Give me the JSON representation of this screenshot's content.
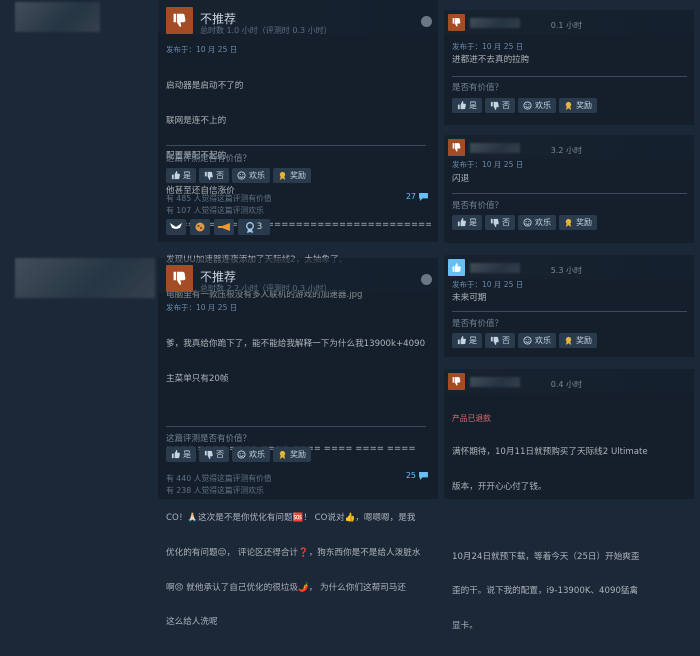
{
  "review1": {
    "verdict": "不推荐",
    "hours": "总时数 1.0 小时（评测时 0.3 小时）",
    "posted": "发布于：10 月 25 日",
    "lines": [
      "启动器是启动不了的",
      "联网是连不上的",
      "配置是配不起的",
      "他甚至还自信涨价",
      "=============================================",
      "发现UU加速器连夜添加了天际线2，太抽象了。",
      "电脑里有一款压根没有多人联机的游戏的加速器.jpg"
    ],
    "helpful_q": "这篇评测是否有价值？",
    "buttons": {
      "yes": "是",
      "no": "否",
      "funny": "欢乐",
      "award": "奖励"
    },
    "stat1": "有 485 人觉得这篇评测有价值",
    "stat2": "有 107 人觉得这篇评测欢乐",
    "comments": "27",
    "award_count": "3"
  },
  "review2": {
    "verdict": "不推荐",
    "hours": "总时数 2.2 小时（评测时 0.3 小时）",
    "posted": "发布于：10 月 25 日",
    "lines": [
      "爹，我真给你跪下了，能不能给我解释一下为什么我13900k+4090",
      "主菜单只有20帧",
      "",
      "==== ==== ==== ==== ==== ==== ==== ====",
      "",
      "CO！🙏🏻这次是不是你优化有问题🆘！ CO说对👍，嗯嗯嗯，是我",
      "优化的有问题😔， 评论区还得合计❓，狗东西你是不是给人泼脏水",
      "啊😠 就他承认了自己优化的很垃圾🌶️， 为什么你们这帮司马还",
      "这么给人洗呢"
    ],
    "helpful_q": "这篇评测是否有价值？",
    "buttons": {
      "yes": "是",
      "no": "否",
      "funny": "欢乐",
      "award": "奖励"
    },
    "stat1": "有 440 人觉得这篇评测有价值",
    "stat2": "有 238 人觉得这篇评测欢乐",
    "comments": "25"
  },
  "right": [
    {
      "hours": "0.1 小时",
      "posted": "发布于：10 月 25 日",
      "text": "进都进不去真的拉胯",
      "helpful_q": "是否有价值？"
    },
    {
      "hours": "3.2 小时",
      "posted": "发布于：10 月 25 日",
      "text": "闪退",
      "helpful_q": "是否有价值？"
    },
    {
      "hours": "5.3 小时",
      "posted": "发布于：10 月 25 日",
      "text": "未来可期",
      "helpful_q": "是否有价值？"
    },
    {
      "hours": "0.4 小时",
      "product": "产品已退款",
      "lines": [
        "满怀期待，10月11日就预购买了天际线2 Ultimate",
        "版本，开开心心付了钱。",
        "",
        "10月24日就预下载，等着今天（25日）开始爽歪",
        "歪的干。说下我的配置，i9-13900K、4090猛禽",
        "显卡。"
      ]
    }
  ],
  "right_buttons": {
    "yes": "是",
    "no": "否",
    "funny": "欢乐",
    "award": "奖励"
  },
  "colors": {
    "background": "#1b2838",
    "thumb_down": "#a34c25",
    "thumb_up": "#66c0f4",
    "link": "#66c0f4"
  }
}
